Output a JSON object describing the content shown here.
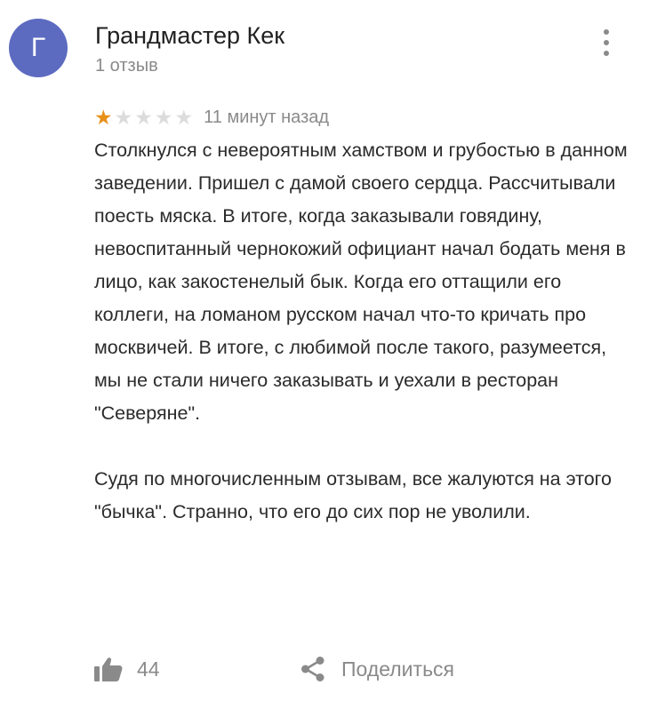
{
  "author": {
    "initial": "Г",
    "name": "Грандмастер Кек",
    "reviews": "1 отзыв"
  },
  "review": {
    "rating": 1,
    "max_rating": 5,
    "time": "11 минут назад",
    "paragraphs": [
      "Столкнулся с невероятным хамством и грубостью в данном заведении. Пришел с дамой своего сердца. Рассчитывали поесть мяска. В итоге, когда заказывали говядину, невоспитанный чернокожий официант начал бодать меня в лицо, как закостенелый бык. Когда его оттащили его коллеги, на ломаном русском начал что-то кричать про москвичей. В итоге, с любимой после такого, разумеется, мы не стали ничего заказывать и уехали в ресторан \"Северяне\".",
      "Судя по многочисленным отзывам, все жалуются на этого \"бычка\". Странно, что его до сих пор не уволили."
    ]
  },
  "actions": {
    "like_count": "44",
    "share_label": "Поделиться",
    "like_icon": "thumb-up-icon",
    "share_icon": "share-icon",
    "menu_icon": "more-vertical-icon"
  },
  "colors": {
    "avatar_bg": "#5c6bc0",
    "star_filled": "#e8901a",
    "star_empty": "#dcdcdc",
    "secondary_text": "#8a8a8a",
    "primary_text": "#2b2b2b"
  }
}
